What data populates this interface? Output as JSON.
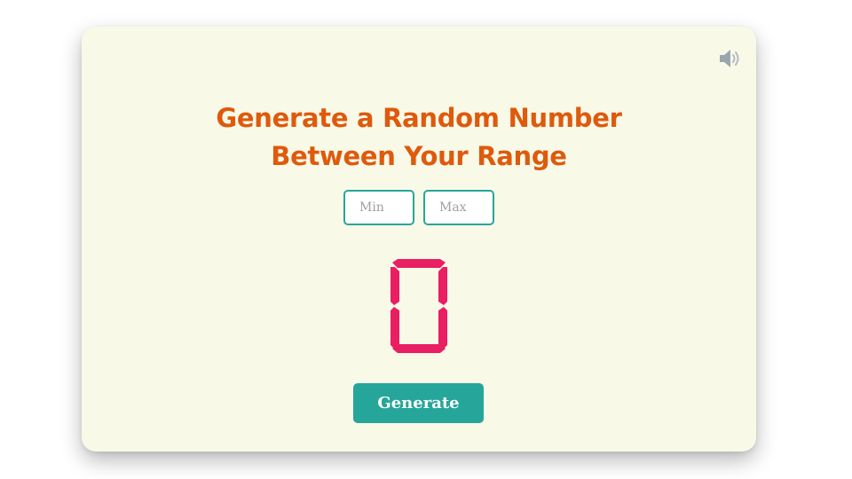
{
  "app": {
    "title_line1": "Generate a Random Number",
    "title_line2": "Between Your Range"
  },
  "sound": {
    "icon": "speaker-volume-icon"
  },
  "range": {
    "min_placeholder": "Min",
    "max_placeholder": "Max",
    "min_value": "",
    "max_value": ""
  },
  "display": {
    "value": "0",
    "color": "#e91e63"
  },
  "generate": {
    "label": "Generate"
  },
  "theme": {
    "card_background": "#f9f9e8",
    "accent": "#26a69a",
    "title_color": "#de5a0c"
  }
}
